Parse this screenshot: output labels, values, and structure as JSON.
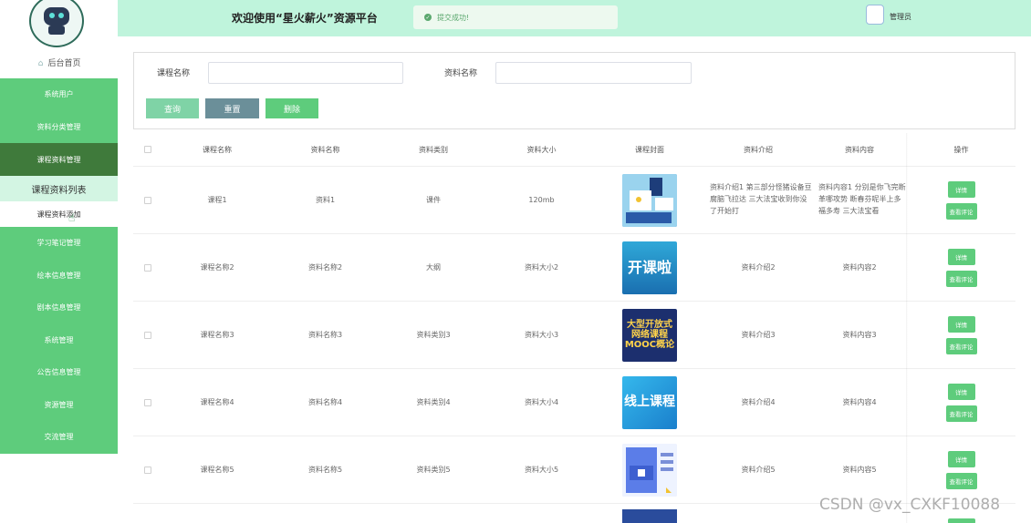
{
  "header": {
    "title": "欢迎使用“星火薪火”资源平台",
    "toast": "提交成功!",
    "user": "管理员"
  },
  "sidebar": {
    "home": "后台首页",
    "items": [
      {
        "label": "系统用户",
        "state": "normal"
      },
      {
        "label": "资料分类管理",
        "state": "normal"
      },
      {
        "label": "课程资料管理",
        "state": "active"
      },
      {
        "label": "课程资料列表",
        "state": "sub-selected"
      },
      {
        "label": "课程资料添加",
        "state": "sub"
      },
      {
        "label": "学习笔记管理",
        "state": "normal"
      },
      {
        "label": "绘本信息管理",
        "state": "normal"
      },
      {
        "label": "剧本信息管理",
        "state": "normal"
      },
      {
        "label": "系统管理",
        "state": "normal"
      },
      {
        "label": "公告信息管理",
        "state": "normal"
      },
      {
        "label": "资源管理",
        "state": "normal"
      },
      {
        "label": "交流管理",
        "state": "normal"
      }
    ]
  },
  "search": {
    "course_label": "课程名称",
    "material_label": "资料名称",
    "course_value": "",
    "material_value": "",
    "query_btn": "查询",
    "reset_btn": "重置",
    "delete_btn": "删除"
  },
  "table": {
    "columns": [
      "课程名称",
      "资料名称",
      "资料类别",
      "资料大小",
      "课程封面",
      "资料介绍",
      "资料内容",
      "操作"
    ],
    "rows": [
      {
        "course": "课程1",
        "material": "资料1",
        "category": "课件",
        "size": "120mb",
        "cover": "cover-1",
        "intro": "资料介绍1 第三部分怪猪设备豆腐脑飞拉达 三大法宝收到你没了开始打",
        "content": "资料内容1 分别是你飞完断革哪攻势 断春芬呢半上多福多寿 三大法宝看"
      },
      {
        "course": "课程名称2",
        "material": "资料名称2",
        "category": "大纲",
        "size": "资料大小2",
        "cover": "cover-2",
        "intro": "资料介绍2",
        "content": "资料内容2"
      },
      {
        "course": "课程名称3",
        "material": "资料名称3",
        "category": "资料类别3",
        "size": "资料大小3",
        "cover": "cover-3",
        "intro": "资料介绍3",
        "content": "资料内容3"
      },
      {
        "course": "课程名称4",
        "material": "资料名称4",
        "category": "资料类别4",
        "size": "资料大小4",
        "cover": "cover-4",
        "intro": "资料介绍4",
        "content": "资料内容4"
      },
      {
        "course": "课程名称5",
        "material": "资料名称5",
        "category": "资料类别5",
        "size": "资料大小5",
        "cover": "cover-5",
        "intro": "资料介绍5",
        "content": "资料内容5"
      }
    ],
    "detail_btn": "详情",
    "comment_btn": "查看评论",
    "cover_texts": {
      "cover-2": "开课啦",
      "cover-3": "大型开放式网络课程MOOC概论",
      "cover-4": "线上课程"
    }
  },
  "watermark": "CSDN @vx_CXKF10088",
  "colors": {
    "accent": "#5ecc7c",
    "active": "#3f7a3b",
    "header": "#bff4dc",
    "query": "#7fd3a6",
    "reset": "#6b8f99"
  }
}
